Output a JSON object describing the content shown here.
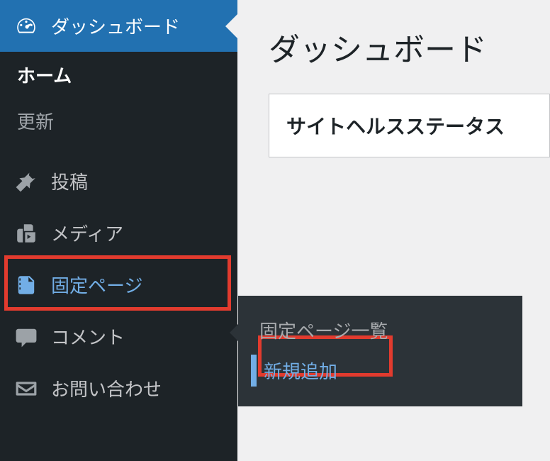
{
  "sidebar": {
    "dashboard": "ダッシュボード",
    "home": "ホーム",
    "updates": "更新",
    "posts": "投稿",
    "media": "メディア",
    "pages": "固定ページ",
    "comments": "コメント",
    "contact": "お問い合わせ"
  },
  "main": {
    "title": "ダッシュボード",
    "site_health_status": "サイトヘルスステータス"
  },
  "flyout": {
    "pages_list": "固定ページ一覧",
    "add_new": "新規追加"
  }
}
